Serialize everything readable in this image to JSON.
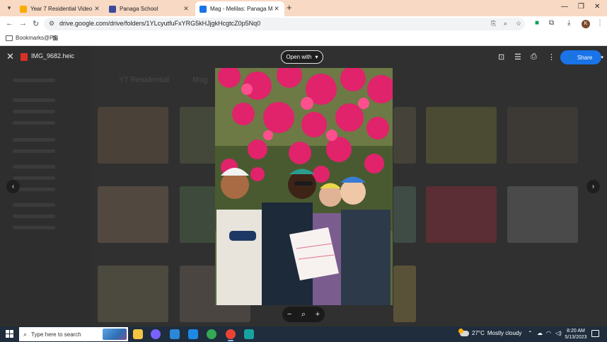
{
  "browser": {
    "tabs": [
      {
        "title": "Year 7 Residential Video - Phot",
        "favicon_color": "#f9ab00",
        "active": false
      },
      {
        "title": "Panaga School",
        "favicon_color": "#3b4a9a",
        "active": false
      },
      {
        "title": "Mag - Melilas: Panaga Middle S",
        "favicon_color": "#1a73e8",
        "active": true
      }
    ],
    "new_tab": "+",
    "url": "drive.google.com/drive/folders/1YLcyutfuFxYRG5kHJjgkHcgtcZ0p5Nq0",
    "bookmarks": [
      {
        "label": "Bookmarks@PS"
      }
    ],
    "profile_initial": "K"
  },
  "viewer": {
    "file_name": "IMG_9682.heic",
    "open_with": "Open with",
    "share": "Share",
    "background_titles": [
      "Y7 Residential",
      "Mag"
    ]
  },
  "taskbar": {
    "search_placeholder": "Type here to search",
    "weather_temp": "27°C",
    "weather_text": "Mostly cloudy",
    "time": "8:20 AM",
    "date": "5/13/2023",
    "apps": [
      {
        "name": "file-explorer",
        "color": "#f4c542"
      },
      {
        "name": "copilot",
        "color": "#7b61ff"
      },
      {
        "name": "store",
        "color": "#2b88d8"
      },
      {
        "name": "mail",
        "color": "#1e88e5"
      },
      {
        "name": "chrome",
        "color": "#34a853"
      },
      {
        "name": "chrome-active",
        "color": "#ea4335"
      },
      {
        "name": "terminal",
        "color": "#16a3a0"
      }
    ]
  },
  "colors": {
    "accent": "#1a73e8",
    "tabstrip": "#f7d9c4",
    "taskbar": "#1f2d3d"
  }
}
